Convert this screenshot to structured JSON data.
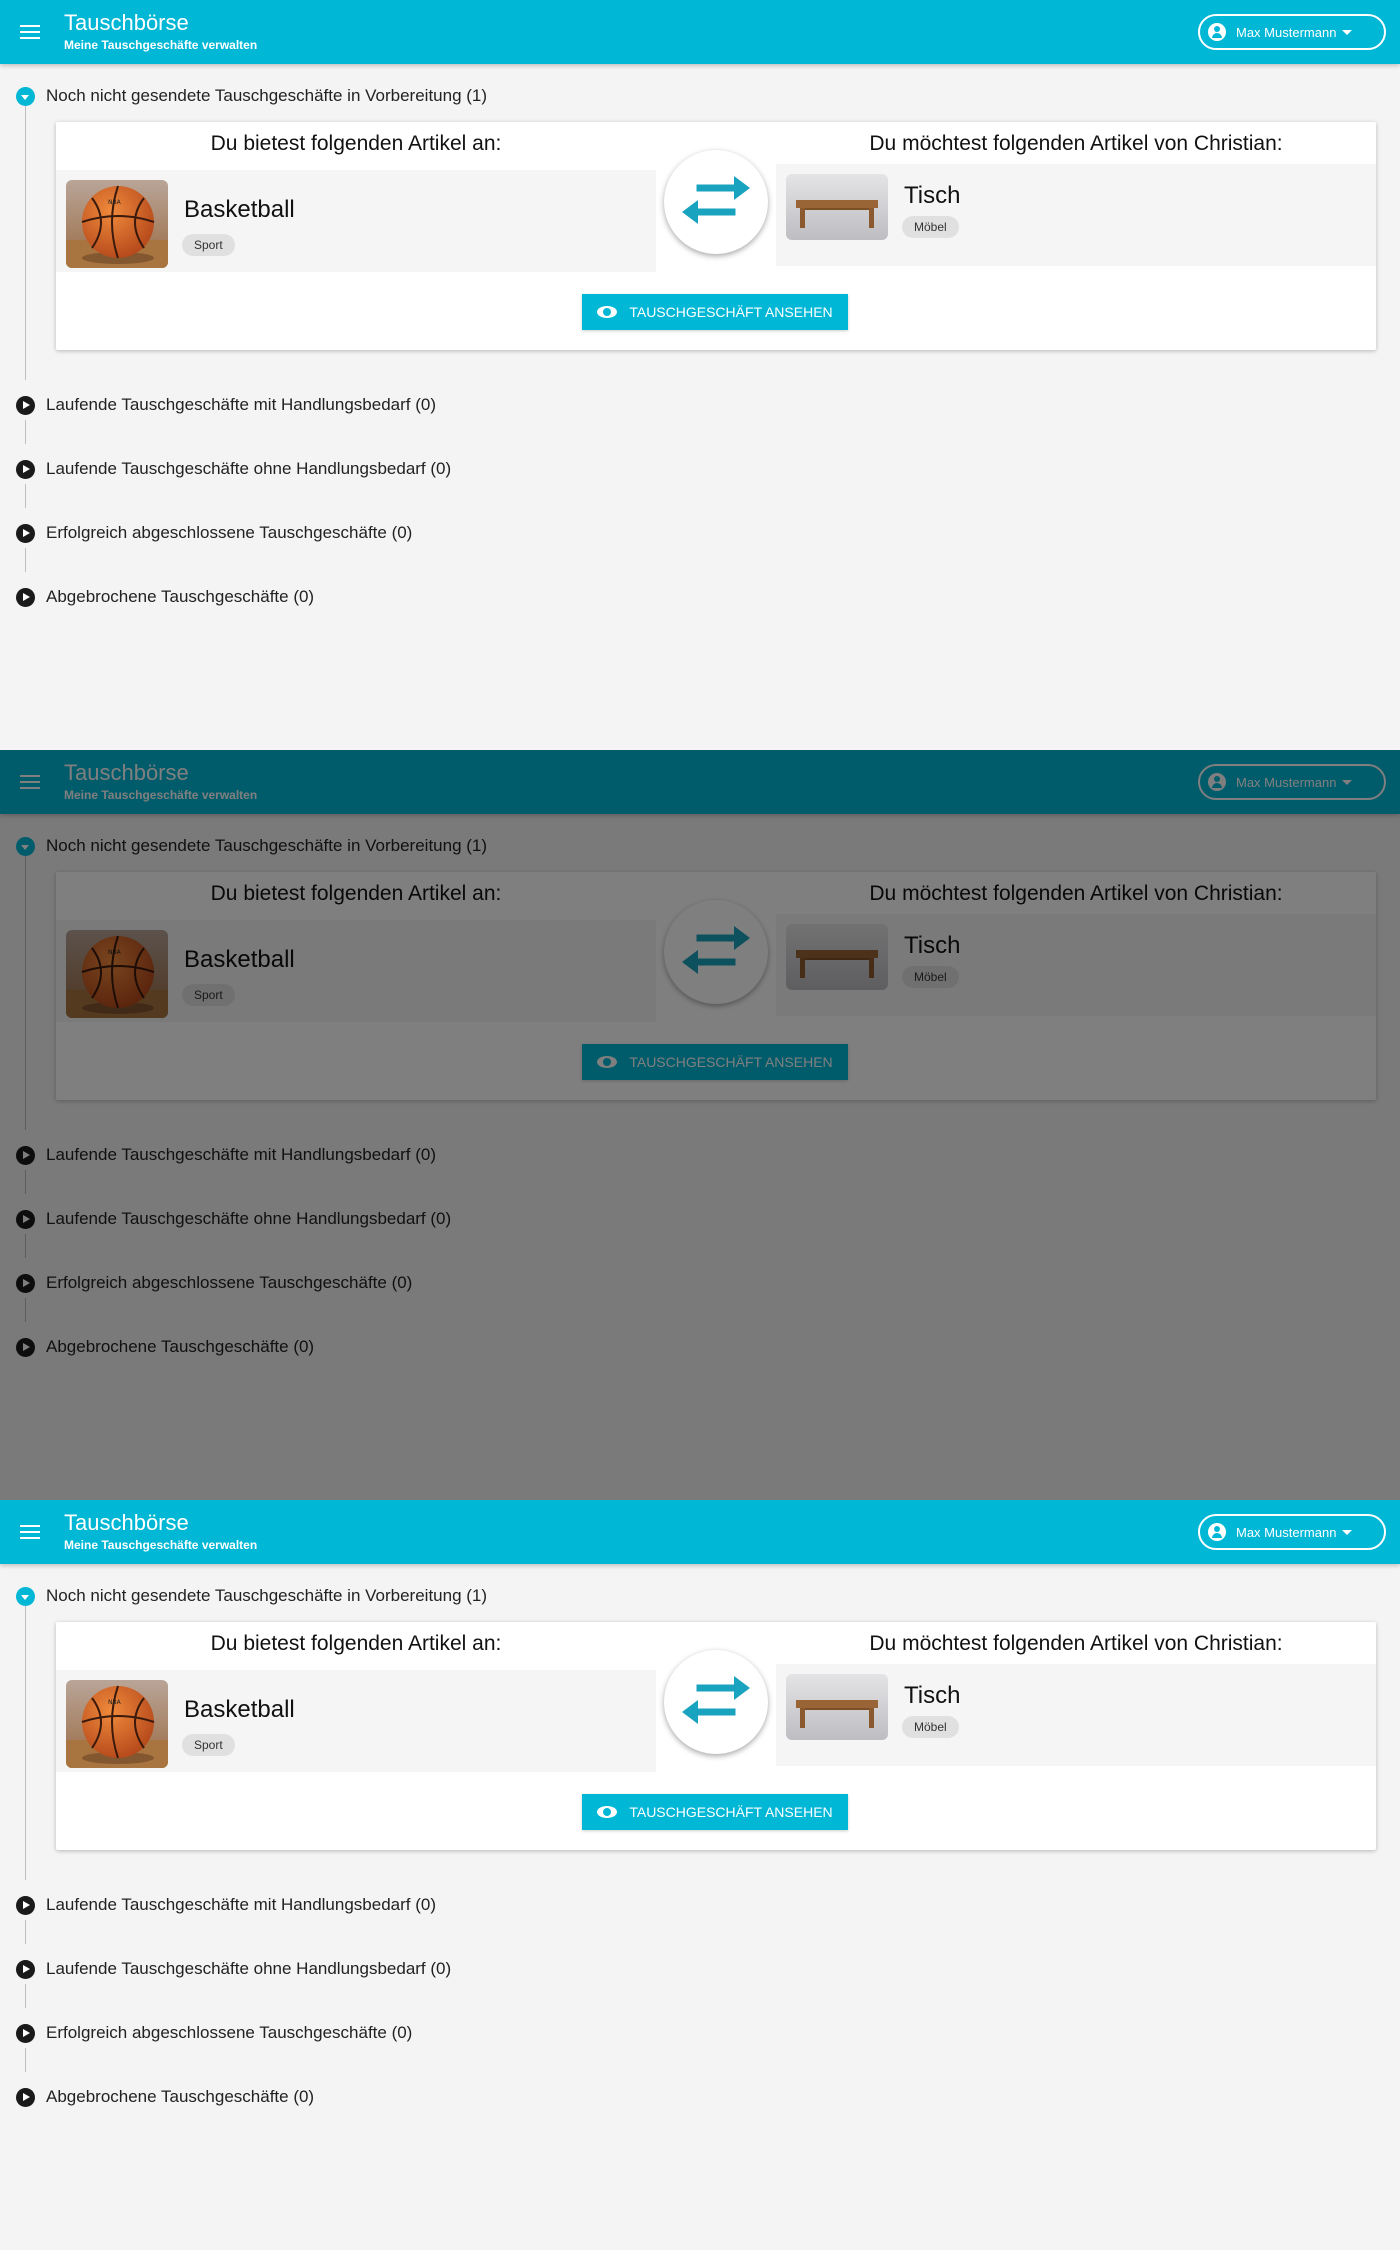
{
  "header": {
    "title": "Tauschbörse",
    "subtitle": "Meine Tauschgeschäfte verwalten",
    "user_name": "Max Mustermann"
  },
  "sections": [
    {
      "label": "Noch nicht gesendete Tauschgeschäfte in Vorbereitung (1)",
      "expanded": true
    },
    {
      "label": "Laufende Tauschgeschäfte mit Handlungsbedarf (0)",
      "expanded": false
    },
    {
      "label": "Laufende Tauschgeschäfte ohne Handlungsbedarf (0)",
      "expanded": false
    },
    {
      "label": "Erfolgreich abgeschlossene Tauschgeschäfte (0)",
      "expanded": false
    },
    {
      "label": "Abgebrochene Tauschgeschäfte (0)",
      "expanded": false
    }
  ],
  "trade": {
    "offer_heading": "Du bietest folgenden Artikel an:",
    "want_heading": "Du möchtest folgenden Artikel von Christian:",
    "offer_item": {
      "name": "Basketball",
      "category": "Sport"
    },
    "want_item": {
      "name": "Tisch",
      "category": "Möbel"
    },
    "view_button": "TAUSCHGESCHÄFT ANSEHEN"
  },
  "frames": [
    {
      "overlay": false
    },
    {
      "overlay": true
    },
    {
      "overlay": false
    }
  ],
  "colors": {
    "accent": "#00b7d6",
    "overlay": "rgba(0,0,0,0.5)"
  },
  "icons": {
    "menu": "menu-icon",
    "user": "account-circle-icon",
    "dropdown": "caret-down-icon",
    "swap": "swap-arrows-icon",
    "eye": "eye-icon",
    "expand": "chevron-circle-icon"
  }
}
